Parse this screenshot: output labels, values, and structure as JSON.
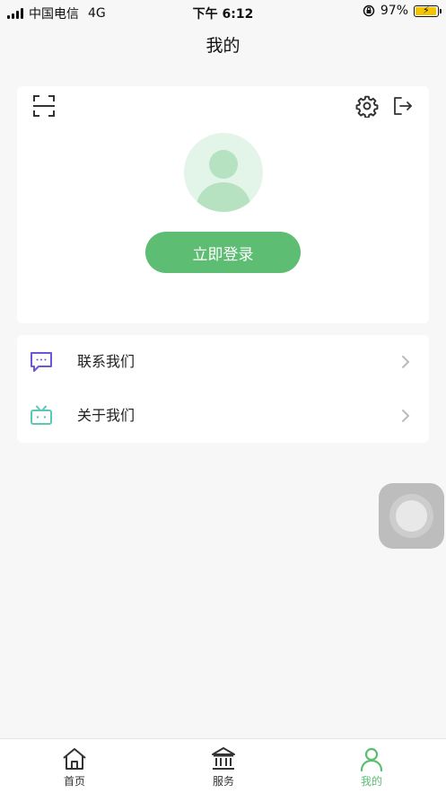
{
  "status_bar": {
    "carrier": "中国电信",
    "network": "4G",
    "time": "下午 6:12",
    "battery": "97%",
    "battery_level": 0.97
  },
  "nav": {
    "title": "我的"
  },
  "profile": {
    "login_label": "立即登录",
    "icons": {
      "scan": "scan-icon",
      "settings": "gear-icon",
      "logout": "logout-icon",
      "avatar": "user-avatar-icon"
    }
  },
  "menu": {
    "items": [
      {
        "label": "联系我们",
        "icon": "chat-bubble-icon",
        "icon_color": "#6f55d6"
      },
      {
        "label": "关于我们",
        "icon": "tv-robot-icon",
        "icon_color": "#5ac8b4"
      }
    ]
  },
  "tabs": [
    {
      "label": "首页",
      "icon": "home-icon",
      "active": false
    },
    {
      "label": "服务",
      "icon": "bank-icon",
      "active": false
    },
    {
      "label": "我的",
      "icon": "user-icon",
      "active": true
    }
  ],
  "colors": {
    "accent": "#5cbd73",
    "avatar_bg": "#e3f4e8",
    "background": "#f7f7f7"
  }
}
